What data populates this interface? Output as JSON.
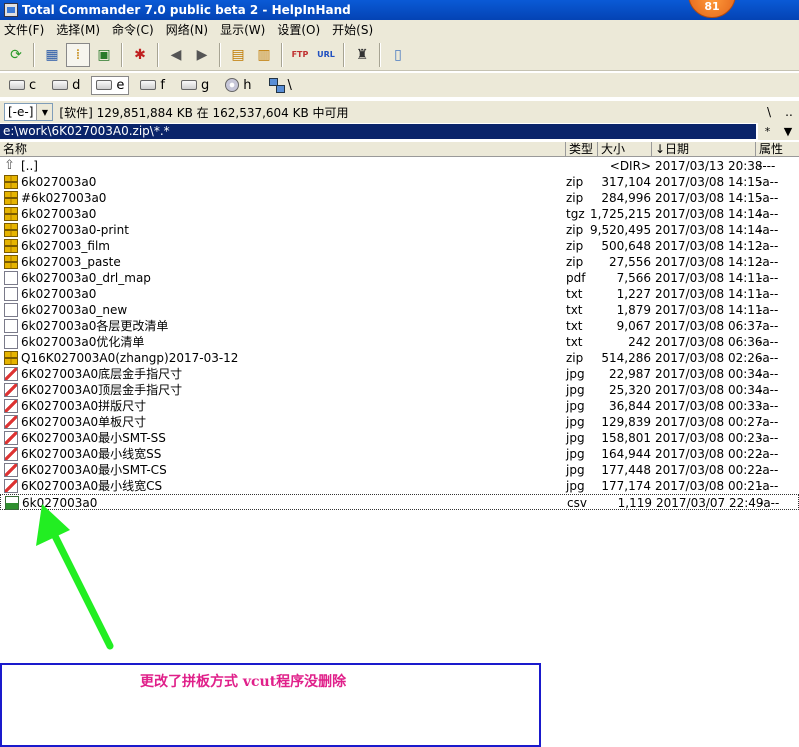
{
  "window": {
    "title": "Total Commander 7.0 public beta 2 - HelpInHand",
    "badge": "81"
  },
  "menu": [
    "文件(F)",
    "选择(M)",
    "命令(C)",
    "网络(N)",
    "显示(W)",
    "设置(O)",
    "开始(S)"
  ],
  "toolbar": {
    "buttons": [
      {
        "name": "refresh-icon",
        "glyph": "⟳",
        "color": "#2a9a2a"
      },
      {
        "name": "brief-view-icon",
        "glyph": "▦",
        "color": "#2a5aa8"
      },
      {
        "name": "full-view-icon",
        "glyph": "⁞",
        "color": "#c08000"
      },
      {
        "name": "thumbnail-view-icon",
        "glyph": "▣",
        "color": "#2a7a2a"
      },
      {
        "name": "invert-selection-icon",
        "glyph": "✱",
        "color": "#c02020"
      },
      {
        "name": "back-icon",
        "glyph": "◀",
        "color": "#555"
      },
      {
        "name": "forward-icon",
        "glyph": "▶",
        "color": "#555"
      },
      {
        "name": "pack-icon",
        "glyph": "▤",
        "color": "#c07a00"
      },
      {
        "name": "unpack-icon",
        "glyph": "▥",
        "color": "#c07a00"
      },
      {
        "name": "ftp-icon",
        "glyph": "FTP",
        "color": "#c03030"
      },
      {
        "name": "url-icon",
        "glyph": "URL",
        "color": "#2050c0"
      },
      {
        "name": "search-icon",
        "glyph": "♜",
        "color": "#333"
      },
      {
        "name": "notepad-icon",
        "glyph": "▯",
        "color": "#4a7ac0"
      }
    ]
  },
  "drives": [
    "c",
    "d",
    "e",
    "f",
    "g",
    "h",
    "\\"
  ],
  "active_drive": "e",
  "infobar": {
    "drive_combo": "[-e-]",
    "free_space": "[软件]  129,851,884 KB 在 162,537,604 KB 中可用",
    "root_btn": "\\",
    "up_btn": ".."
  },
  "path": "e:\\work\\6K027003A0.zip\\*.*",
  "path_tools": {
    "filter": "*",
    "history": "▼"
  },
  "columns": {
    "name": "名称",
    "ext": "类型",
    "size": "大小",
    "date": "↓日期",
    "attr": "属性"
  },
  "files": [
    {
      "icon": "up",
      "name": "[..]",
      "ext": "",
      "size": "<DIR>",
      "date": "2017/03/13 20:38",
      "attr": "----"
    },
    {
      "icon": "zip",
      "name": "6k027003a0",
      "ext": "zip",
      "size": "317,104",
      "date": "2017/03/08 14:15",
      "attr": "-a--"
    },
    {
      "icon": "zip",
      "name": "#6k027003a0",
      "ext": "zip",
      "size": "284,996",
      "date": "2017/03/08 14:15",
      "attr": "-a--"
    },
    {
      "icon": "zip",
      "name": "6k027003a0",
      "ext": "tgz",
      "size": "1,725,215",
      "date": "2017/03/08 14:14",
      "attr": "-a--"
    },
    {
      "icon": "zip",
      "name": "6k027003a0-print",
      "ext": "zip",
      "size": "9,520,495",
      "date": "2017/03/08 14:14",
      "attr": "-a--"
    },
    {
      "icon": "zip",
      "name": "6k027003_film",
      "ext": "zip",
      "size": "500,648",
      "date": "2017/03/08 14:12",
      "attr": "-a--"
    },
    {
      "icon": "zip",
      "name": "6k027003_paste",
      "ext": "zip",
      "size": "27,556",
      "date": "2017/03/08 14:12",
      "attr": "-a--"
    },
    {
      "icon": "file",
      "name": "6k027003a0_drl_map",
      "ext": "pdf",
      "size": "7,566",
      "date": "2017/03/08 14:11",
      "attr": "-a--"
    },
    {
      "icon": "file",
      "name": "6k027003a0",
      "ext": "txt",
      "size": "1,227",
      "date": "2017/03/08 14:11",
      "attr": "-a--"
    },
    {
      "icon": "file",
      "name": "6k027003a0_new",
      "ext": "txt",
      "size": "1,879",
      "date": "2017/03/08 14:11",
      "attr": "-a--"
    },
    {
      "icon": "file",
      "name": "6k027003a0各层更改清单",
      "ext": "txt",
      "size": "9,067",
      "date": "2017/03/08 06:37",
      "attr": "-a--"
    },
    {
      "icon": "file",
      "name": "6k027003a0优化清单",
      "ext": "txt",
      "size": "242",
      "date": "2017/03/08 06:36",
      "attr": "-a--"
    },
    {
      "icon": "zip",
      "name": "Q16K027003A0(zhangp)2017-03-12",
      "ext": "zip",
      "size": "514,286",
      "date": "2017/03/08 02:26",
      "attr": "-a--"
    },
    {
      "icon": "jpg",
      "name": "6K027003A0底层金手指尺寸",
      "ext": "jpg",
      "size": "22,987",
      "date": "2017/03/08 00:34",
      "attr": "-a--"
    },
    {
      "icon": "jpg",
      "name": "6K027003A0顶层金手指尺寸",
      "ext": "jpg",
      "size": "25,320",
      "date": "2017/03/08 00:34",
      "attr": "-a--"
    },
    {
      "icon": "jpg",
      "name": "6K027003A0拼版尺寸",
      "ext": "jpg",
      "size": "36,844",
      "date": "2017/03/08 00:33",
      "attr": "-a--"
    },
    {
      "icon": "jpg",
      "name": "6K027003A0单板尺寸",
      "ext": "jpg",
      "size": "129,839",
      "date": "2017/03/08 00:27",
      "attr": "-a--"
    },
    {
      "icon": "jpg",
      "name": "6K027003A0最小SMT-SS",
      "ext": "jpg",
      "size": "158,801",
      "date": "2017/03/08 00:23",
      "attr": "-a--"
    },
    {
      "icon": "jpg",
      "name": "6K027003A0最小线宽SS",
      "ext": "jpg",
      "size": "164,944",
      "date": "2017/03/08 00:22",
      "attr": "-a--"
    },
    {
      "icon": "jpg",
      "name": "6K027003A0最小SMT-CS",
      "ext": "jpg",
      "size": "177,448",
      "date": "2017/03/08 00:22",
      "attr": "-a--"
    },
    {
      "icon": "jpg",
      "name": "6K027003A0最小线宽CS",
      "ext": "jpg",
      "size": "177,174",
      "date": "2017/03/08 00:21",
      "attr": "-a--"
    },
    {
      "icon": "csv",
      "name": "6k027003a0",
      "ext": "csv",
      "size": "1,119",
      "date": "2017/03/07 22:49",
      "attr": "-a--"
    }
  ],
  "cursor_row": 21,
  "annotation": {
    "text": "更改了拼板方式   vcut程序没删除",
    "text_color": "#e0208a",
    "arrow_color": "#22ee22",
    "box_color": "#1a1acc"
  }
}
